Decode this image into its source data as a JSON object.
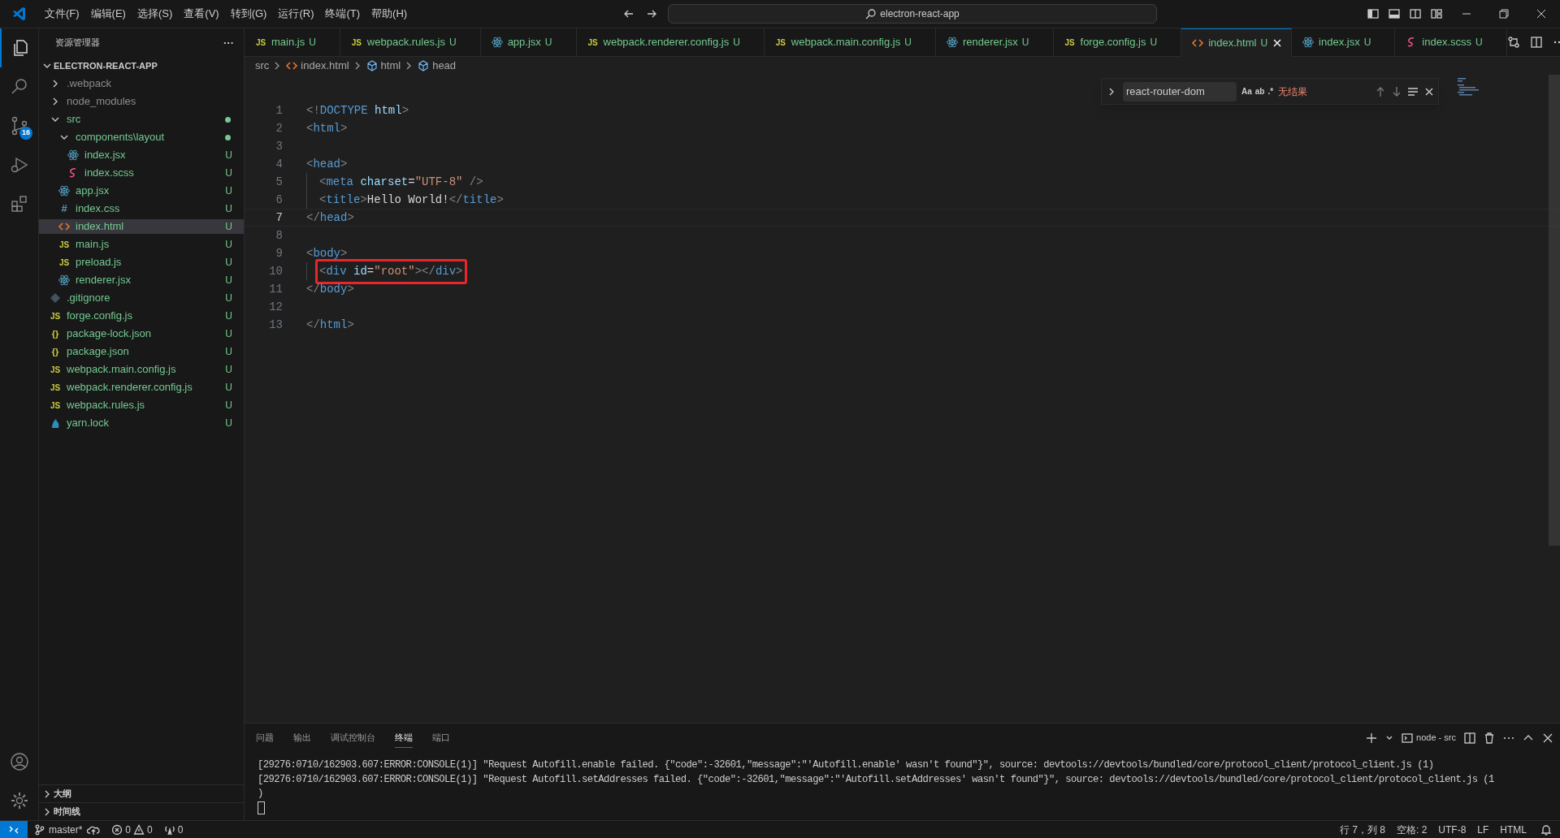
{
  "title_bar": {
    "menu": [
      "文件(F)",
      "编辑(E)",
      "选择(S)",
      "查看(V)",
      "转到(G)",
      "运行(R)",
      "终端(T)",
      "帮助(H)"
    ],
    "search": "electron-react-app"
  },
  "activity_bar": {
    "source_control_badge": "16"
  },
  "sidebar": {
    "title": "资源管理器",
    "more": "···",
    "section": "ELECTRON-REACT-APP",
    "tree": [
      {
        "label": ".webpack",
        "kind": "folder",
        "expanded": false,
        "dimmed": true,
        "selected": false
      },
      {
        "label": "node_modules",
        "kind": "folder",
        "expanded": false,
        "dimmed": true,
        "selected": false
      },
      {
        "label": "src",
        "kind": "folder",
        "expanded": true,
        "dot": true,
        "selected": false,
        "children": [
          {
            "label": "components\\layout",
            "kind": "folder",
            "expanded": true,
            "dot": true,
            "selected": false,
            "children": [
              {
                "label": "index.jsx",
                "kind": "react",
                "badge": "U",
                "selected": false
              },
              {
                "label": "index.scss",
                "kind": "scss",
                "badge": "U",
                "selected": false
              }
            ]
          },
          {
            "label": "app.jsx",
            "kind": "react",
            "badge": "U",
            "selected": false
          },
          {
            "label": "index.css",
            "kind": "css",
            "glyph": "#",
            "badge": "U",
            "selected": false
          },
          {
            "label": "index.html",
            "kind": "html",
            "badge": "U",
            "selected": true
          },
          {
            "label": "main.js",
            "kind": "js",
            "glyph": "JS",
            "badge": "U",
            "selected": false
          },
          {
            "label": "preload.js",
            "kind": "js",
            "glyph": "JS",
            "badge": "U",
            "selected": false
          },
          {
            "label": "renderer.jsx",
            "kind": "react",
            "badge": "U",
            "selected": false
          }
        ]
      },
      {
        "label": ".gitignore",
        "kind": "git",
        "badge": "U",
        "selected": false
      },
      {
        "label": "forge.config.js",
        "kind": "js",
        "glyph": "JS",
        "badge": "U",
        "selected": false
      },
      {
        "label": "package-lock.json",
        "kind": "json",
        "glyph": "{}",
        "badge": "U",
        "selected": false
      },
      {
        "label": "package.json",
        "kind": "json",
        "glyph": "{}",
        "badge": "U",
        "selected": false
      },
      {
        "label": "webpack.main.config.js",
        "kind": "js",
        "glyph": "JS",
        "badge": "U",
        "selected": false
      },
      {
        "label": "webpack.renderer.config.js",
        "kind": "js",
        "glyph": "JS",
        "badge": "U",
        "selected": false
      },
      {
        "label": "webpack.rules.js",
        "kind": "js",
        "glyph": "JS",
        "badge": "U",
        "selected": false
      },
      {
        "label": "yarn.lock",
        "kind": "yarn",
        "badge": "U",
        "selected": false
      }
    ],
    "bottom_sections": [
      "大纲",
      "时间线"
    ]
  },
  "tabs": [
    {
      "label": "main.js",
      "kind": "js",
      "glyph": "JS",
      "badge": "U",
      "selected": false
    },
    {
      "label": "webpack.rules.js",
      "kind": "js",
      "glyph": "JS",
      "badge": "U",
      "selected": false
    },
    {
      "label": "app.jsx",
      "kind": "react",
      "badge": "U",
      "selected": false
    },
    {
      "label": "webpack.renderer.config.js",
      "kind": "js",
      "glyph": "JS",
      "badge": "U",
      "selected": false
    },
    {
      "label": "webpack.main.config.js",
      "kind": "js",
      "glyph": "JS",
      "badge": "U",
      "selected": false
    },
    {
      "label": "renderer.jsx",
      "kind": "react",
      "badge": "U",
      "selected": false
    },
    {
      "label": "forge.config.js",
      "kind": "js",
      "glyph": "JS",
      "badge": "U",
      "selected": false
    },
    {
      "label": "index.html",
      "kind": "html",
      "badge": "U",
      "selected": true
    },
    {
      "label": "index.jsx",
      "kind": "react",
      "badge": "U",
      "selected": false
    },
    {
      "label": "index.scss",
      "kind": "scss",
      "badge": "U",
      "selected": false
    }
  ],
  "breadcrumb": [
    {
      "label": "src",
      "kind": "folder"
    },
    {
      "label": "index.html",
      "kind": "html"
    },
    {
      "label": "html",
      "kind": "element"
    },
    {
      "label": "head",
      "kind": "element"
    }
  ],
  "find_widget": {
    "query": "react-router-dom",
    "options": [
      "Aa",
      "ab",
      ".*"
    ],
    "result": "无结果"
  },
  "code": [
    {
      "number": "1",
      "tokens": [
        {
          "kind": "bracket",
          "text": "<!"
        },
        {
          "kind": "tag",
          "text": "DOCTYPE"
        },
        {
          "kind": "attr",
          "text": " html"
        },
        {
          "kind": "bracket",
          "text": ">"
        }
      ]
    },
    {
      "number": "2",
      "tokens": [
        {
          "kind": "bracket",
          "text": "<"
        },
        {
          "kind": "tag",
          "text": "html"
        },
        {
          "kind": "bracket",
          "text": ">"
        }
      ]
    },
    {
      "number": "3"
    },
    {
      "number": "4",
      "tokens": [
        {
          "kind": "bracket",
          "text": "<"
        },
        {
          "kind": "tag",
          "text": "head"
        },
        {
          "kind": "bracket",
          "text": ">"
        }
      ]
    },
    {
      "number": "5",
      "indented": true,
      "tokens": [
        {
          "kind": "bracket",
          "text": "<"
        },
        {
          "kind": "tag",
          "text": "meta"
        },
        {
          "kind": "attr",
          "text": " charset"
        },
        {
          "kind": "text",
          "text": "="
        },
        {
          "kind": "string",
          "text": "\"UTF-8\""
        },
        {
          "kind": "bracket",
          "text": " />"
        }
      ]
    },
    {
      "number": "6",
      "indented": true,
      "tokens": [
        {
          "kind": "bracket",
          "text": "<"
        },
        {
          "kind": "tag",
          "text": "title"
        },
        {
          "kind": "bracket",
          "text": ">"
        },
        {
          "kind": "text",
          "text": "Hello World!"
        },
        {
          "kind": "bracket",
          "text": "</"
        },
        {
          "kind": "tag",
          "text": "title"
        },
        {
          "kind": "bracket",
          "text": ">"
        }
      ]
    },
    {
      "number": "7",
      "current": true,
      "tokens": [
        {
          "kind": "bracket",
          "text": "</"
        },
        {
          "kind": "tag",
          "text": "head"
        },
        {
          "kind": "bracket",
          "text": ">"
        }
      ]
    },
    {
      "number": "8"
    },
    {
      "number": "9",
      "tokens": [
        {
          "kind": "bracket",
          "text": "<"
        },
        {
          "kind": "tag",
          "text": "body"
        },
        {
          "kind": "bracket",
          "text": ">"
        }
      ]
    },
    {
      "number": "10",
      "indented": true,
      "highlighted": true,
      "tokens": [
        {
          "kind": "bracket",
          "text": "<"
        },
        {
          "kind": "tag",
          "text": "div"
        },
        {
          "kind": "attr",
          "text": " id"
        },
        {
          "kind": "text",
          "text": "="
        },
        {
          "kind": "string",
          "text": "\"root\""
        },
        {
          "kind": "bracket",
          "text": "></"
        },
        {
          "kind": "tag",
          "text": "div"
        },
        {
          "kind": "bracket",
          "text": ">"
        }
      ]
    },
    {
      "number": "11",
      "tokens": [
        {
          "kind": "bracket",
          "text": "</"
        },
        {
          "kind": "tag",
          "text": "body"
        },
        {
          "kind": "bracket",
          "text": ">"
        }
      ]
    },
    {
      "number": "12"
    },
    {
      "number": "13",
      "tokens": [
        {
          "kind": "bracket",
          "text": "</"
        },
        {
          "kind": "tag",
          "text": "html"
        },
        {
          "kind": "bracket",
          "text": ">"
        }
      ]
    }
  ],
  "panel": {
    "tabs": [
      {
        "label": "问题",
        "selected": false
      },
      {
        "label": "输出",
        "selected": false
      },
      {
        "label": "调试控制台",
        "selected": false
      },
      {
        "label": "终端",
        "selected": true
      },
      {
        "label": "端口",
        "selected": false
      }
    ],
    "terminal_name": "node - src",
    "terminal_lines": [
      "[29276:0710/162903.607:ERROR:CONSOLE(1)] \"Request Autofill.enable failed. {\"code\":-32601,\"message\":\"'Autofill.enable' wasn't found\"}\", source: devtools://devtools/bundled/core/protocol_client/protocol_client.js (1)",
      "[29276:0710/162903.607:ERROR:CONSOLE(1)] \"Request Autofill.setAddresses failed. {\"code\":-32601,\"message\":\"'Autofill.setAddresses' wasn't found\"}\", source: devtools://devtools/bundled/core/protocol_client/protocol_client.js (1",
      ")"
    ]
  },
  "status_bar": {
    "branch": "master*",
    "errors": "0",
    "warnings": "0",
    "ports": "0",
    "right": [
      "行 7，列 8",
      "空格: 2",
      "UTF-8",
      "LF",
      "HTML"
    ]
  }
}
